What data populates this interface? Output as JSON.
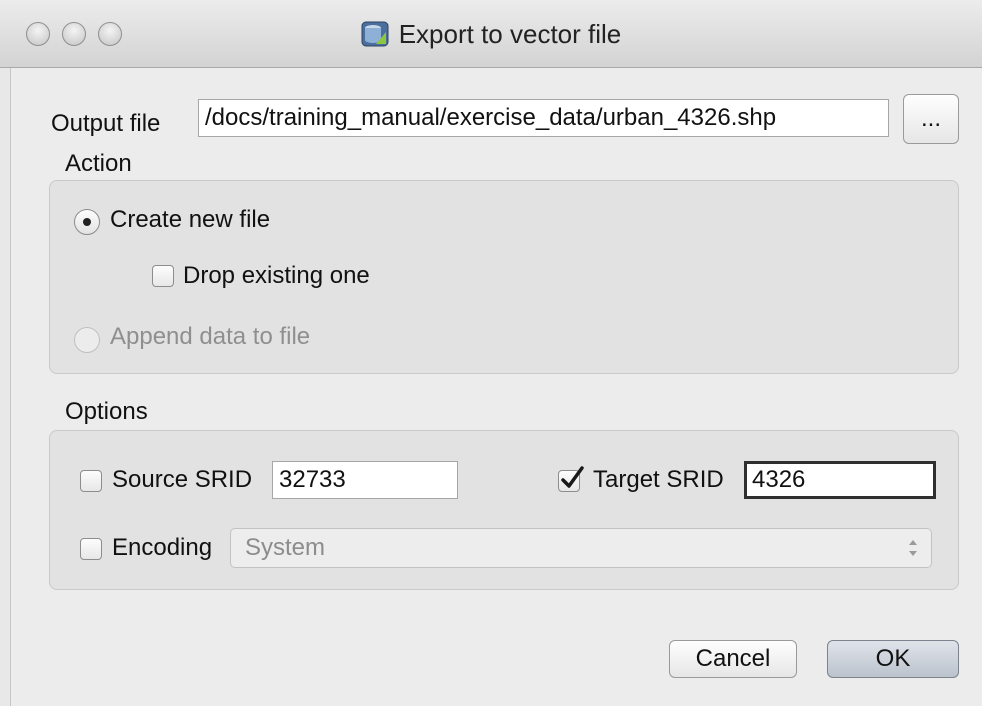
{
  "window": {
    "title": "Export to vector file",
    "app_icon": "qgis-db-manager-icon"
  },
  "output": {
    "label": "Output file",
    "value": "/docs/training_manual/exercise_data/urban_4326.shp",
    "browse_label": "..."
  },
  "action": {
    "heading": "Action",
    "create_new": {
      "label": "Create new file",
      "checked": true
    },
    "drop_existing": {
      "label": "Drop existing one",
      "checked": false
    },
    "append": {
      "label": "Append data to file",
      "checked": false,
      "enabled": false
    }
  },
  "options": {
    "heading": "Options",
    "source_srid": {
      "label": "Source SRID",
      "checked": false,
      "value": "32733"
    },
    "target_srid": {
      "label": "Target SRID",
      "checked": true,
      "value": "4326"
    },
    "encoding": {
      "label": "Encoding",
      "checked": false,
      "selected": "System"
    }
  },
  "buttons": {
    "cancel": "Cancel",
    "ok": "OK"
  },
  "colors": {
    "window_bg": "#ececec",
    "group_bg": "#e2e2e2",
    "disabled_text": "#8f8f8f"
  }
}
